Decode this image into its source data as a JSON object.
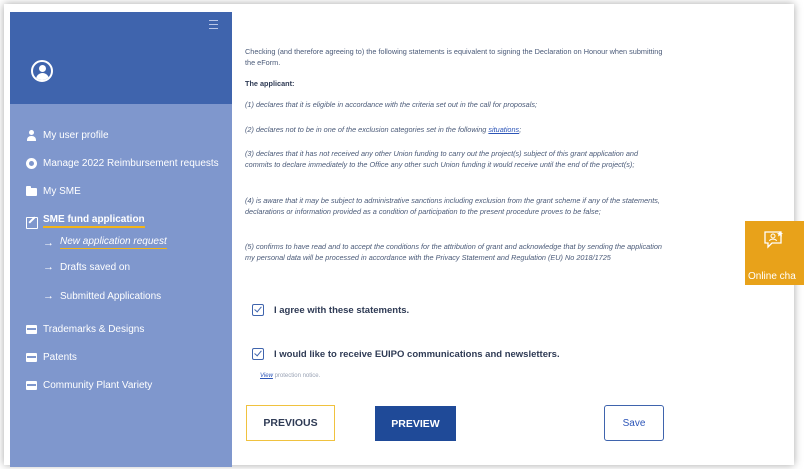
{
  "sidebar": {
    "items": [
      {
        "label": "My user profile",
        "icon": "user-icon"
      },
      {
        "label": "Manage 2022 Reimbursement requests",
        "icon": "gear-icon"
      },
      {
        "label": "My SME",
        "icon": "folder-icon"
      },
      {
        "label": "SME fund application",
        "icon": "edit-icon",
        "active": true
      },
      {
        "label": "Trademarks & Designs",
        "icon": "card-icon"
      },
      {
        "label": "Patents",
        "icon": "card-icon"
      },
      {
        "label": "Community Plant Variety",
        "icon": "card-icon"
      }
    ],
    "subitems": [
      {
        "label": "New application request",
        "current": true
      },
      {
        "label": "Drafts saved on"
      },
      {
        "label": "Submitted Applications"
      }
    ]
  },
  "declaration": {
    "intro": "Checking (and therefore agreeing to) the following statements is equivalent to signing the Declaration on Honour when submitting the eForm.",
    "applicant_heading": "The applicant:",
    "s1": "(1) declares that it is eligible in accordance with the criteria set out in the call for proposals;",
    "s2_prefix": "(2) declares not to be in one of the exclusion categories set in the following ",
    "s2_link": "situations",
    "s2_suffix": ";",
    "s3": "(3) declares that it has not received any other Union funding to carry out the project(s) subject of this grant application and commits to declare immediately to the Office any other such Union funding it would receive until the end of the project(s);",
    "s4": "(4) is aware that it may be subject to administrative sanctions including exclusion from the grant scheme if any of the statements, declarations or information provided as a condition of participation to the present procedure proves to be false;",
    "s5": "(5) confirms to have read and to accept the conditions for the attribution of grant and acknowledge that by sending the application my personal data will be processed in accordance with the Privacy Statement and Regulation (EU) No 2018/1725"
  },
  "checks": {
    "agree_label": "I agree with these statements.",
    "agree_checked": true,
    "newsletter_label": "I would like to receive EUIPO communications and newsletters.",
    "newsletter_checked": true
  },
  "notice": {
    "view_link": "View",
    "text": " protection notice."
  },
  "buttons": {
    "previous": "PREVIOUS",
    "preview": "PREVIEW",
    "save": "Save"
  },
  "chat": {
    "label": "Online cha"
  },
  "colors": {
    "sidebar_bg": "#7f97cd",
    "sidebar_top": "#3f64ad",
    "accent": "#f3b516",
    "primary": "#1f4a98",
    "chat": "#e8a21a"
  }
}
